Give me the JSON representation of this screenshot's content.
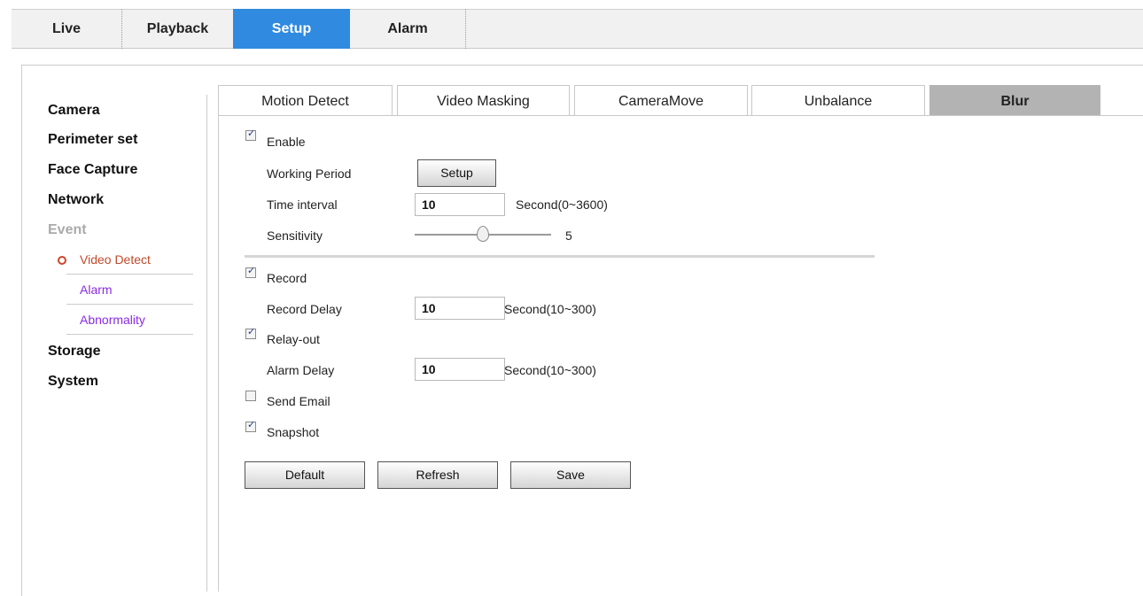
{
  "topnav": {
    "tabs": [
      {
        "label": "Live"
      },
      {
        "label": "Playback"
      },
      {
        "label": "Setup"
      },
      {
        "label": "Alarm"
      }
    ],
    "active_color": "#2f8ae0"
  },
  "sidebar": {
    "items": [
      {
        "label": "Camera"
      },
      {
        "label": "Perimeter set"
      },
      {
        "label": "Face Capture"
      },
      {
        "label": "Network"
      },
      {
        "label": "Event"
      },
      {
        "label": "Storage"
      },
      {
        "label": "System"
      }
    ],
    "event_sub": [
      {
        "label": "Video Detect",
        "active": true
      },
      {
        "label": "Alarm"
      },
      {
        "label": "Abnormality"
      }
    ]
  },
  "subtabs": [
    {
      "label": "Motion Detect"
    },
    {
      "label": "Video Masking"
    },
    {
      "label": "CameraMove"
    },
    {
      "label": "Unbalance"
    },
    {
      "label": "Blur",
      "active": true
    }
  ],
  "form": {
    "enable": {
      "label": "Enable",
      "checked": true
    },
    "working_period": {
      "label": "Working Period",
      "button": "Setup"
    },
    "time_interval": {
      "label": "Time interval",
      "value": "10",
      "unit": "Second(0~3600)"
    },
    "sensitivity": {
      "label": "Sensitivity",
      "value": "5"
    },
    "record": {
      "label": "Record",
      "checked": true
    },
    "record_delay": {
      "label": "Record Delay",
      "value": "10",
      "unit": "Second(10~300)"
    },
    "relay_out": {
      "label": "Relay-out",
      "checked": true
    },
    "alarm_delay": {
      "label": "Alarm Delay",
      "value": "10",
      "unit": "Second(10~300)"
    },
    "send_email": {
      "label": "Send Email",
      "checked": false
    },
    "snapshot": {
      "label": "Snapshot",
      "checked": true
    }
  },
  "buttons": {
    "default": "Default",
    "refresh": "Refresh",
    "save": "Save"
  }
}
